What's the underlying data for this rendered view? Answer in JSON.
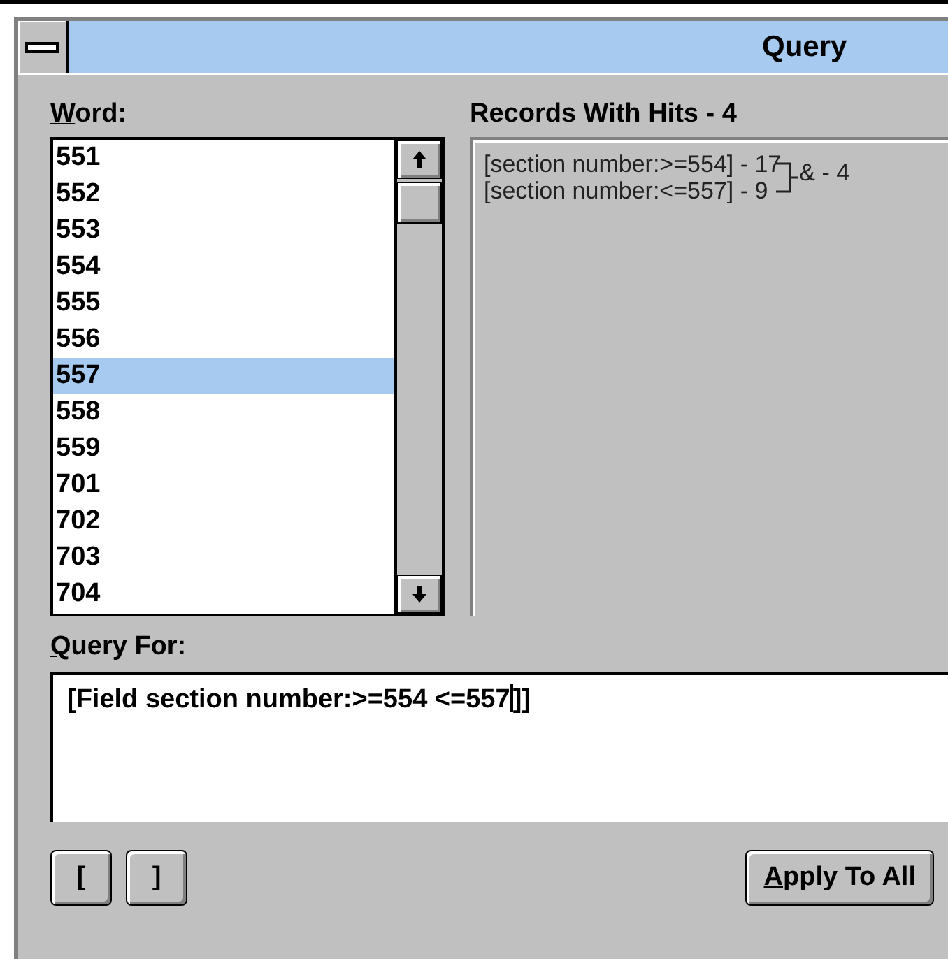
{
  "window": {
    "title": "Query"
  },
  "word_list": {
    "label": "Word:",
    "underline_first": true,
    "items": [
      {
        "text": "551",
        "selected": false
      },
      {
        "text": "552",
        "selected": false
      },
      {
        "text": "553",
        "selected": false
      },
      {
        "text": "554",
        "selected": false
      },
      {
        "text": "555",
        "selected": false
      },
      {
        "text": "556",
        "selected": false
      },
      {
        "text": "557",
        "selected": true
      },
      {
        "text": "558",
        "selected": false
      },
      {
        "text": "559",
        "selected": false
      },
      {
        "text": "701",
        "selected": false
      },
      {
        "text": "702",
        "selected": false
      },
      {
        "text": "703",
        "selected": false
      },
      {
        "text": "704",
        "selected": false
      }
    ]
  },
  "records": {
    "label": "Records With Hits - 4",
    "lines": [
      {
        "text": "[section number:>=554] - 17"
      },
      {
        "text": "[section number:<=557] - 9"
      }
    ],
    "combined": "& - 4"
  },
  "query": {
    "label": "Query For:",
    "underline_first": true,
    "text_before_caret": "[Field section number:>=554 <=557",
    "text_after_caret": "]]"
  },
  "buttons": [
    {
      "label": "["
    },
    {
      "label": "]"
    },
    {
      "label": "Apply To All",
      "underline_first": true
    }
  ]
}
